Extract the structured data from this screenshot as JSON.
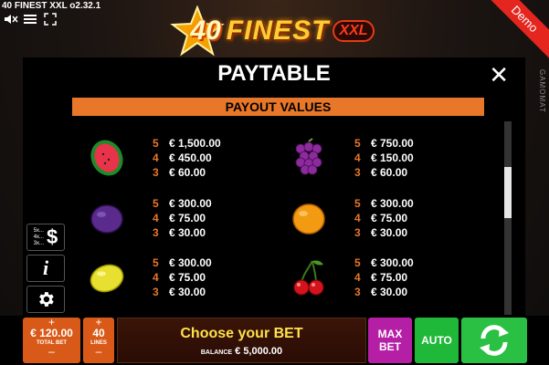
{
  "app": {
    "version": "40 FINEST XXL o2.32.1",
    "demo_label": "Demo",
    "provider": "GAMOMAT"
  },
  "logo": {
    "number": "40",
    "word": "FINEST",
    "badge": "XXL"
  },
  "paytable": {
    "title": "PAYTABLE",
    "section": "PAYOUT VALUES",
    "rows": [
      {
        "icon": "watermelon-icon",
        "pays": [
          {
            "n": "5",
            "v": "€ 1,500.00"
          },
          {
            "n": "4",
            "v": "€ 450.00"
          },
          {
            "n": "3",
            "v": "€ 60.00"
          }
        ]
      },
      {
        "icon": "grapes-icon",
        "pays": [
          {
            "n": "5",
            "v": "€ 750.00"
          },
          {
            "n": "4",
            "v": "€ 150.00"
          },
          {
            "n": "3",
            "v": "€ 60.00"
          }
        ]
      },
      {
        "icon": "plum-icon",
        "pays": [
          {
            "n": "5",
            "v": "€ 300.00"
          },
          {
            "n": "4",
            "v": "€ 75.00"
          },
          {
            "n": "3",
            "v": "€ 30.00"
          }
        ]
      },
      {
        "icon": "orange-icon",
        "pays": [
          {
            "n": "5",
            "v": "€ 300.00"
          },
          {
            "n": "4",
            "v": "€ 75.00"
          },
          {
            "n": "3",
            "v": "€ 30.00"
          }
        ]
      },
      {
        "icon": "lemon-icon",
        "pays": [
          {
            "n": "5",
            "v": "€ 300.00"
          },
          {
            "n": "4",
            "v": "€ 75.00"
          },
          {
            "n": "3",
            "v": "€ 30.00"
          }
        ]
      },
      {
        "icon": "cherries-icon",
        "pays": [
          {
            "n": "5",
            "v": "€ 300.00"
          },
          {
            "n": "4",
            "v": "€ 75.00"
          },
          {
            "n": "3",
            "v": "€ 30.00"
          }
        ]
      }
    ]
  },
  "side": {
    "paylines_mini": [
      "5x...",
      "4x...",
      "3x..."
    ],
    "dollar": "$",
    "info": "i"
  },
  "bottom": {
    "plus": "+",
    "minus": "–",
    "total_bet_value": "€ 120.00",
    "total_bet_label": "TOTAL BET",
    "lines_value": "40",
    "lines_label": "LINES",
    "choose_title": "Choose your BET",
    "balance_label": "BALANCE",
    "balance_value": "€ 5,000.00",
    "max_bet": [
      "MAX",
      "BET"
    ],
    "auto": "AUTO"
  },
  "colors": {
    "accent": "#e8772a",
    "demo": "#e4261f",
    "max_bet": "#b51fa6",
    "auto": "#1fb838"
  }
}
